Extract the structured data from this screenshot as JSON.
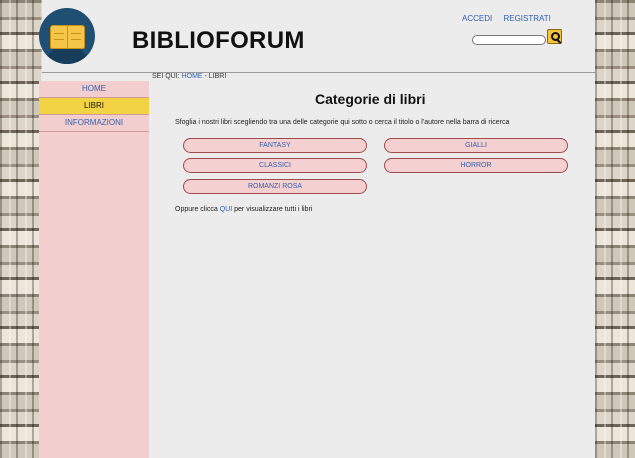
{
  "header": {
    "site_title": "BIBLIOFORUM",
    "links": {
      "login": "ACCEDI",
      "register": "REGISTRATI"
    },
    "search": {
      "value": ""
    }
  },
  "sidebar": {
    "items": [
      {
        "label": "HOME",
        "active": false
      },
      {
        "label": "LIBRI",
        "active": true
      },
      {
        "label": "INFORMAZIONI",
        "active": false
      }
    ]
  },
  "breadcrumb": {
    "prefix": "SEI QUI: ",
    "home": "HOME",
    "separator": " - ",
    "current": "LIBRI"
  },
  "main": {
    "heading": "Categorie di libri",
    "intro": "Sfoglia i nostri libri scegliendo tra una delle categorie qui sotto o cerca il titolo o l'autore nella barra di ricerca",
    "categories": [
      "FANTASY",
      "GIALLI",
      "CLASSICI",
      "HORROR",
      "ROMANZI ROSA"
    ],
    "view_all": {
      "before": "Oppure clicca ",
      "link": "QUI",
      "after": " per visualizzare tutti i libri"
    }
  },
  "colors": {
    "accent_yellow": "#f2d343",
    "sidebar_pink": "#f3cece",
    "link_blue": "#3060b0",
    "logo_blue": "#1f4f73"
  },
  "icons": [
    "book-logo-icon",
    "search-icon"
  ]
}
